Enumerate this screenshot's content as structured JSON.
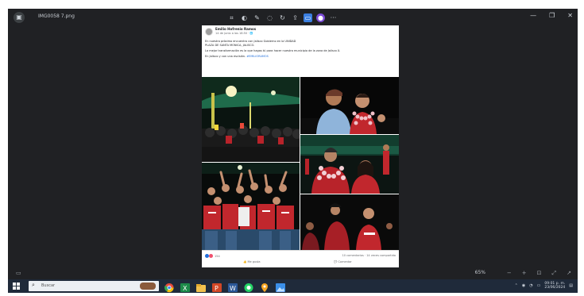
{
  "window": {
    "title": "IMG0058 7.png"
  },
  "toolbar": {
    "icons": [
      "crop-icon",
      "adjust-icon",
      "draw-icon",
      "erase-icon",
      "rotate-icon",
      "share-icon",
      "folder-icon",
      "paint-icon",
      "more-icon"
    ]
  },
  "post": {
    "page_name": "Emilio Hofrenio Ramos",
    "date": "14 de junio a las 18:50 · 🌐",
    "paragraphs": [
      "En nuestro próximo encuentro con Jalisco Gobierno en la UNIDAD",
      "PLAZA DE SANTA MONICA, JALISCO.",
      "La mejor transformación es la que hagas tú para hacer nuestro municipio de la zona de Jalisco X.",
      "En Jalisco y con una escisión."
    ],
    "link_text": "#EMILIORAMOS",
    "reactions_count": "154",
    "counts_text": "10 comentarios · 14 veces compartido",
    "like_label": "Me gusta",
    "comment_label": "Comentar"
  },
  "viewer": {
    "zoom": "65%"
  },
  "taskbar": {
    "search_placeholder": "Buscar",
    "clock_time": "09:01 p. m.",
    "clock_date": "23/06/2024"
  },
  "colors": {
    "accent": "#216fdb",
    "viewer_bg": "#202124",
    "taskbar_bg": "#1f2a3a",
    "shirt_red": "#c1272d"
  }
}
